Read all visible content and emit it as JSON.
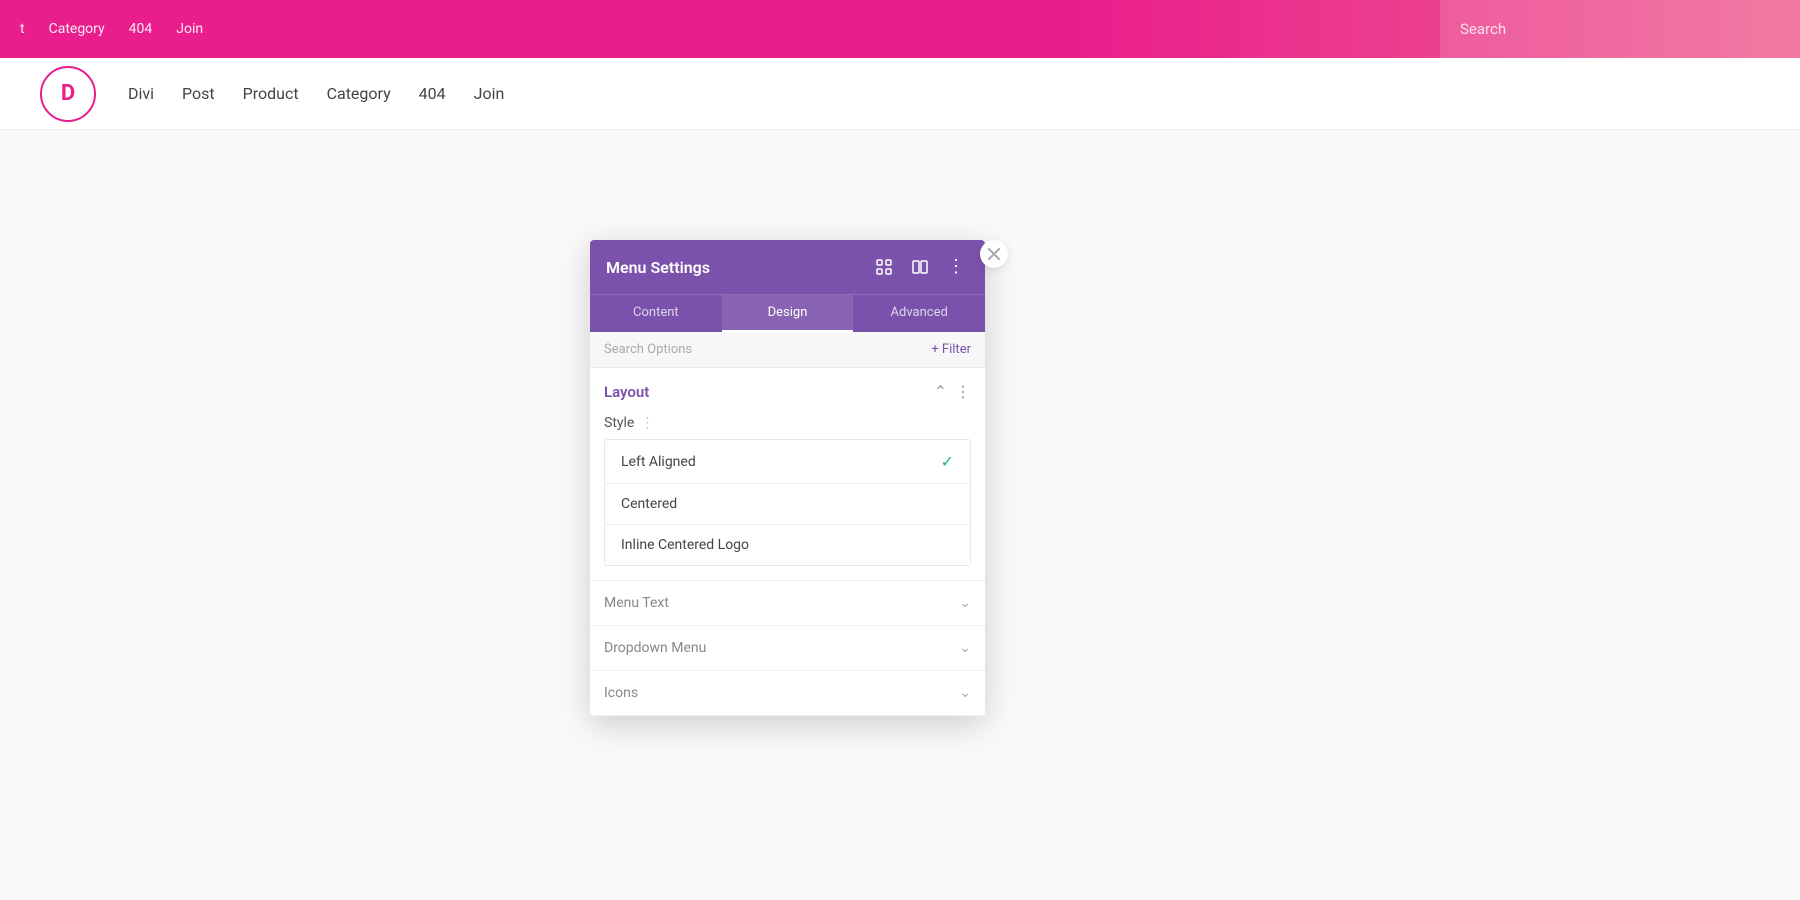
{
  "adminBar": {
    "items": [
      "t",
      "Category",
      "404",
      "Join"
    ],
    "search": "Search"
  },
  "mainNav": {
    "logo": "D",
    "items": [
      "Divi",
      "Post",
      "Product",
      "Category",
      "404",
      "Join"
    ]
  },
  "panel": {
    "title": "Menu Settings",
    "icons": {
      "fullscreen": "⛶",
      "split": "⧉",
      "more": "⋮"
    },
    "tabs": [
      "Content",
      "Design",
      "Advanced"
    ],
    "activeTab": "Design",
    "searchPlaceholder": "Search Options",
    "filterLabel": "+ Filter",
    "sections": {
      "layout": {
        "title": "Layout",
        "styleLabel": "Style",
        "options": [
          {
            "label": "Left Aligned",
            "selected": true
          },
          {
            "label": "Centered",
            "selected": false
          },
          {
            "label": "Inline Centered Logo",
            "selected": false
          }
        ]
      },
      "menuText": {
        "title": "Menu Text",
        "collapsed": true
      },
      "dropdownMenu": {
        "title": "Dropdown Menu",
        "collapsed": true
      },
      "icons": {
        "title": "Icons",
        "collapsed": true
      }
    }
  }
}
